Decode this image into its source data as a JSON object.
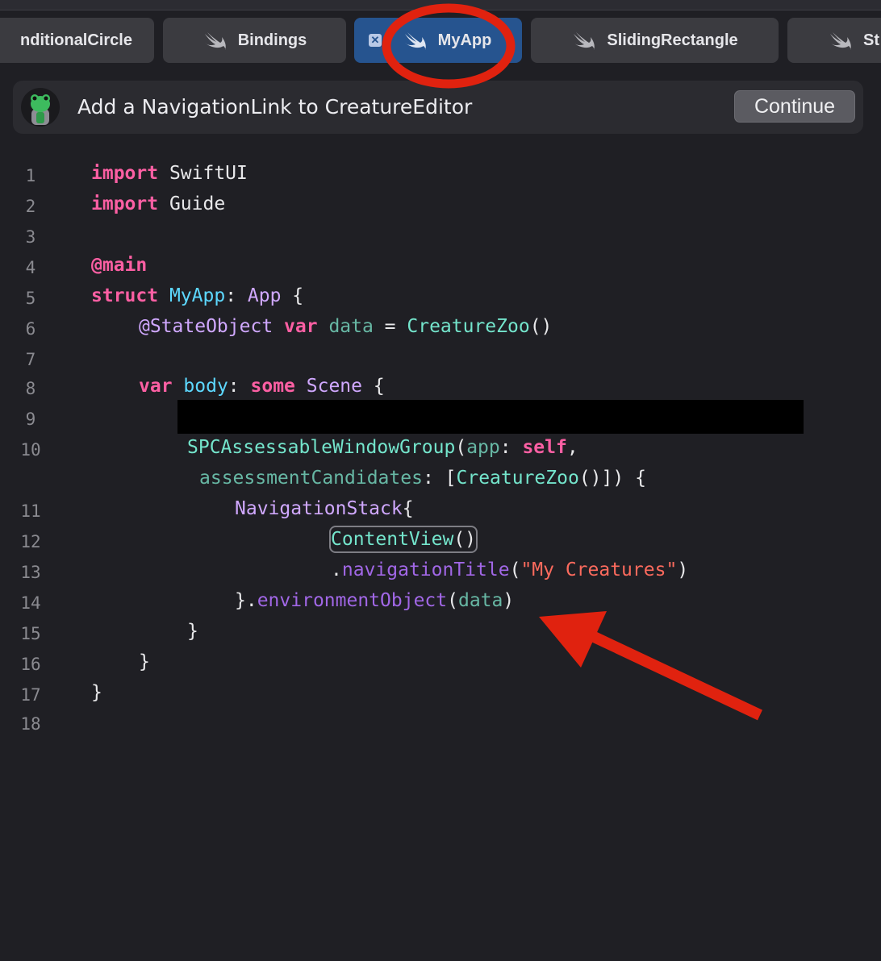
{
  "tabs": [
    {
      "label": "nditionalCircle",
      "active": false
    },
    {
      "label": "Bindings",
      "active": false
    },
    {
      "label": "MyApp",
      "active": true
    },
    {
      "label": "SlidingRectangle",
      "active": false
    },
    {
      "label": "St",
      "active": false
    }
  ],
  "guide": {
    "title": "Add a NavigationLink to CreatureEditor",
    "continue_label": "Continue"
  },
  "line_numbers": [
    "1",
    "2",
    "3",
    "4",
    "5",
    "6",
    "7",
    "8",
    "9",
    "10",
    "11",
    "12",
    "13",
    "14",
    "15",
    "16",
    "17",
    "18"
  ],
  "code": {
    "l1": {
      "kw": "import",
      "rest": " SwiftUI"
    },
    "l2": {
      "kw": "import",
      "rest": " Guide"
    },
    "l4": {
      "kw": "@main"
    },
    "l5": {
      "kw": "struct",
      "name": "MyApp",
      "colon": ": ",
      "type": "App",
      "tail": " {"
    },
    "l6": {
      "attr": "@StateObject",
      "kw": "var",
      "var": "data",
      "eq": " = ",
      "call": "CreatureZoo",
      "tail": "()"
    },
    "l8": {
      "kw": "var",
      "name": "body",
      "colon": ": ",
      "kw2": "some",
      "type": "Scene",
      "tail": " {"
    },
    "l10": {
      "call": "SPCAssessableWindowGroup",
      "open": "(",
      "param": "app",
      "colon": ": ",
      "kw": "self",
      "tail": ","
    },
    "l10b": {
      "param": "assessmentCandidates",
      "colon": ": [",
      "call": "CreatureZoo",
      "tail": "()]) {"
    },
    "l11": {
      "type": "NavigationStack",
      "tail": "{"
    },
    "l12": {
      "call": "ContentView",
      "tail": "()"
    },
    "l13": {
      "dot": ".",
      "fn": "navigationTitle",
      "open": "(",
      "str": "\"My Creatures\"",
      "tail": ")"
    },
    "l14": {
      "head": "}.",
      "fn": "environmentObject",
      "open": "(",
      "arg": "data",
      "tail": ")"
    },
    "l15": {
      "text": "}"
    },
    "l16": {
      "text": "}"
    },
    "l17": {
      "text": "}"
    }
  },
  "colors": {
    "keyword": "#fc5fa3",
    "type": "#d0a8ff",
    "declared_type": "#5dd8ff",
    "function": "#a167e6",
    "string": "#fc6a5d",
    "annotation_red": "#e0220f",
    "active_tab": "#26548f"
  }
}
